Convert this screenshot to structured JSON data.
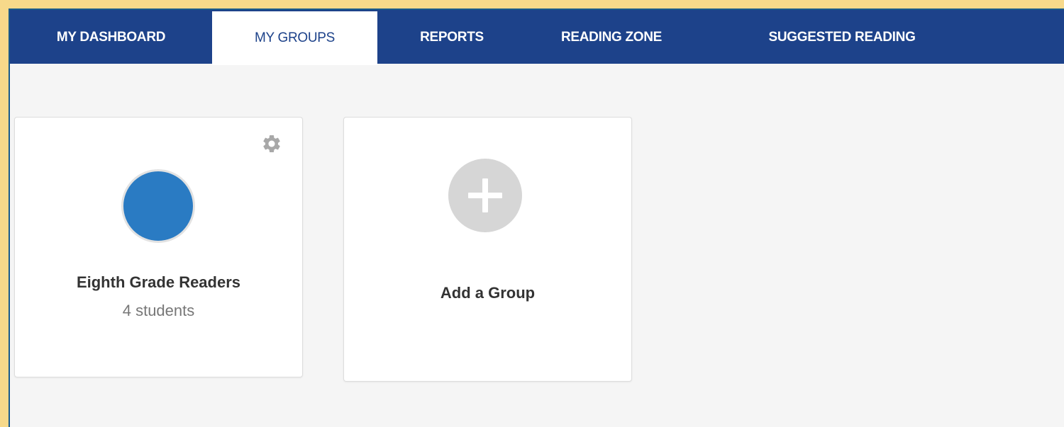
{
  "nav": {
    "tabs": [
      {
        "label": "MY DASHBOARD",
        "active": false
      },
      {
        "label": "MY GROUPS",
        "active": true
      },
      {
        "label": "REPORTS",
        "active": false
      },
      {
        "label": "READING ZONE",
        "active": false
      },
      {
        "label": "SUGGESTED READING",
        "active": false
      }
    ]
  },
  "groups": [
    {
      "name": "Eighth Grade Readers",
      "count_text": "4 students",
      "avatar_color": "#2a7bc3",
      "settings_icon": "gear-icon"
    }
  ],
  "add_group": {
    "label": "Add a Group",
    "icon": "plus-icon"
  },
  "colors": {
    "nav_background": "#1d428a",
    "outer_background": "#f7d98a",
    "page_background": "#f5f5f5"
  }
}
